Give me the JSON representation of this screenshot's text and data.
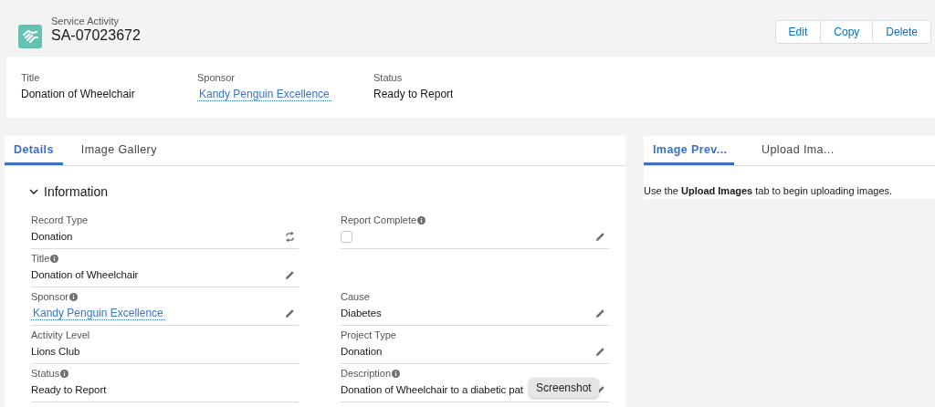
{
  "header": {
    "object_type": "Service Activity",
    "record_name": "SA-07023672",
    "actions": [
      "Edit",
      "Copy",
      "Delete"
    ]
  },
  "highlights": [
    {
      "label": "Title",
      "value": "Donation of Wheelchair",
      "kind": "text"
    },
    {
      "label": "Sponsor",
      "value": "Kandy Penguin Excellence",
      "kind": "link"
    },
    {
      "label": "Status",
      "value": "Ready to Report",
      "kind": "text"
    }
  ],
  "main_tabs": [
    {
      "label": "Details",
      "selected": true
    },
    {
      "label": "Image Gallery",
      "selected": false
    }
  ],
  "section": {
    "title": "Information",
    "expanded": true
  },
  "rows": [
    {
      "cells": [
        {
          "label": "Record Type",
          "info": false,
          "kind": "text",
          "value": "Donation",
          "editable": false,
          "switchable": true
        },
        {
          "label": "Report Complete",
          "info": true,
          "kind": "checkbox",
          "checked": false,
          "editable": true,
          "switchable": false
        }
      ]
    },
    {
      "cells": [
        {
          "label": "Title",
          "info": true,
          "kind": "text",
          "value": "Donation of Wheelchair",
          "editable": true,
          "switchable": false
        }
      ]
    },
    {
      "cells": [
        {
          "label": "Sponsor",
          "info": true,
          "kind": "link",
          "value": "Kandy Penguin Excellence",
          "editable": true,
          "switchable": false
        },
        {
          "label": "Cause",
          "info": false,
          "kind": "text",
          "value": "Diabetes",
          "editable": true,
          "switchable": false
        }
      ]
    },
    {
      "cells": [
        {
          "label": "Activity Level",
          "info": false,
          "kind": "text",
          "value": "Lions Club",
          "editable": false,
          "switchable": false
        },
        {
          "label": "Project Type",
          "info": false,
          "kind": "text",
          "value": "Donation",
          "editable": true,
          "switchable": false
        }
      ]
    },
    {
      "cells": [
        {
          "label": "Status",
          "info": true,
          "kind": "text",
          "value": "Ready to Report",
          "editable": false,
          "switchable": false
        },
        {
          "label": "Description",
          "info": true,
          "kind": "text",
          "value": "Donation of Wheelchair to a diabetic pat",
          "editable": true,
          "switchable": false
        }
      ]
    }
  ],
  "side_tabs": [
    {
      "label": "Image Prev...",
      "selected": true
    },
    {
      "label": "Upload Ima...",
      "selected": false
    }
  ],
  "side_message": "Use the **Upload Images** tab to begin uploading images.",
  "tooltip": "Screenshot"
}
